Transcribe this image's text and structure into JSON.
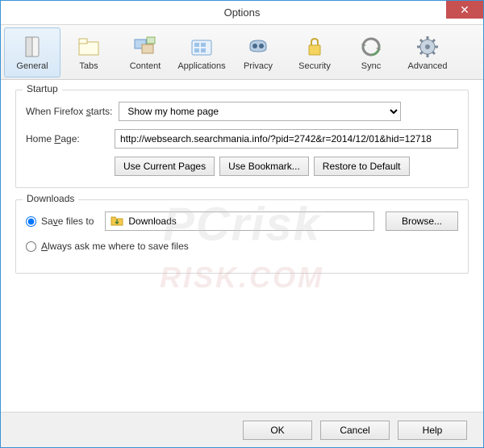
{
  "window": {
    "title": "Options"
  },
  "toolbar": {
    "items": [
      {
        "label": "General"
      },
      {
        "label": "Tabs"
      },
      {
        "label": "Content"
      },
      {
        "label": "Applications"
      },
      {
        "label": "Privacy"
      },
      {
        "label": "Security"
      },
      {
        "label": "Sync"
      },
      {
        "label": "Advanced"
      }
    ]
  },
  "startup": {
    "title": "Startup",
    "when_label": "When Firefox starts:",
    "when_value": "Show my home page",
    "homepage_label": "Home Page:",
    "homepage_value": "http://websearch.searchmania.info/?pid=2742&r=2014/12/01&hid=12718",
    "use_current": "Use Current Pages",
    "use_bookmark": "Use Bookmark...",
    "restore_default": "Restore to Default"
  },
  "downloads": {
    "title": "Downloads",
    "save_to": "Save files to",
    "folder": "Downloads",
    "browse": "Browse...",
    "always_ask": "Always ask me where to save files"
  },
  "buttons": {
    "ok": "OK",
    "cancel": "Cancel",
    "help": "Help"
  },
  "watermark": {
    "line1": "PCrisk",
    "line2": "RISK.COM"
  }
}
